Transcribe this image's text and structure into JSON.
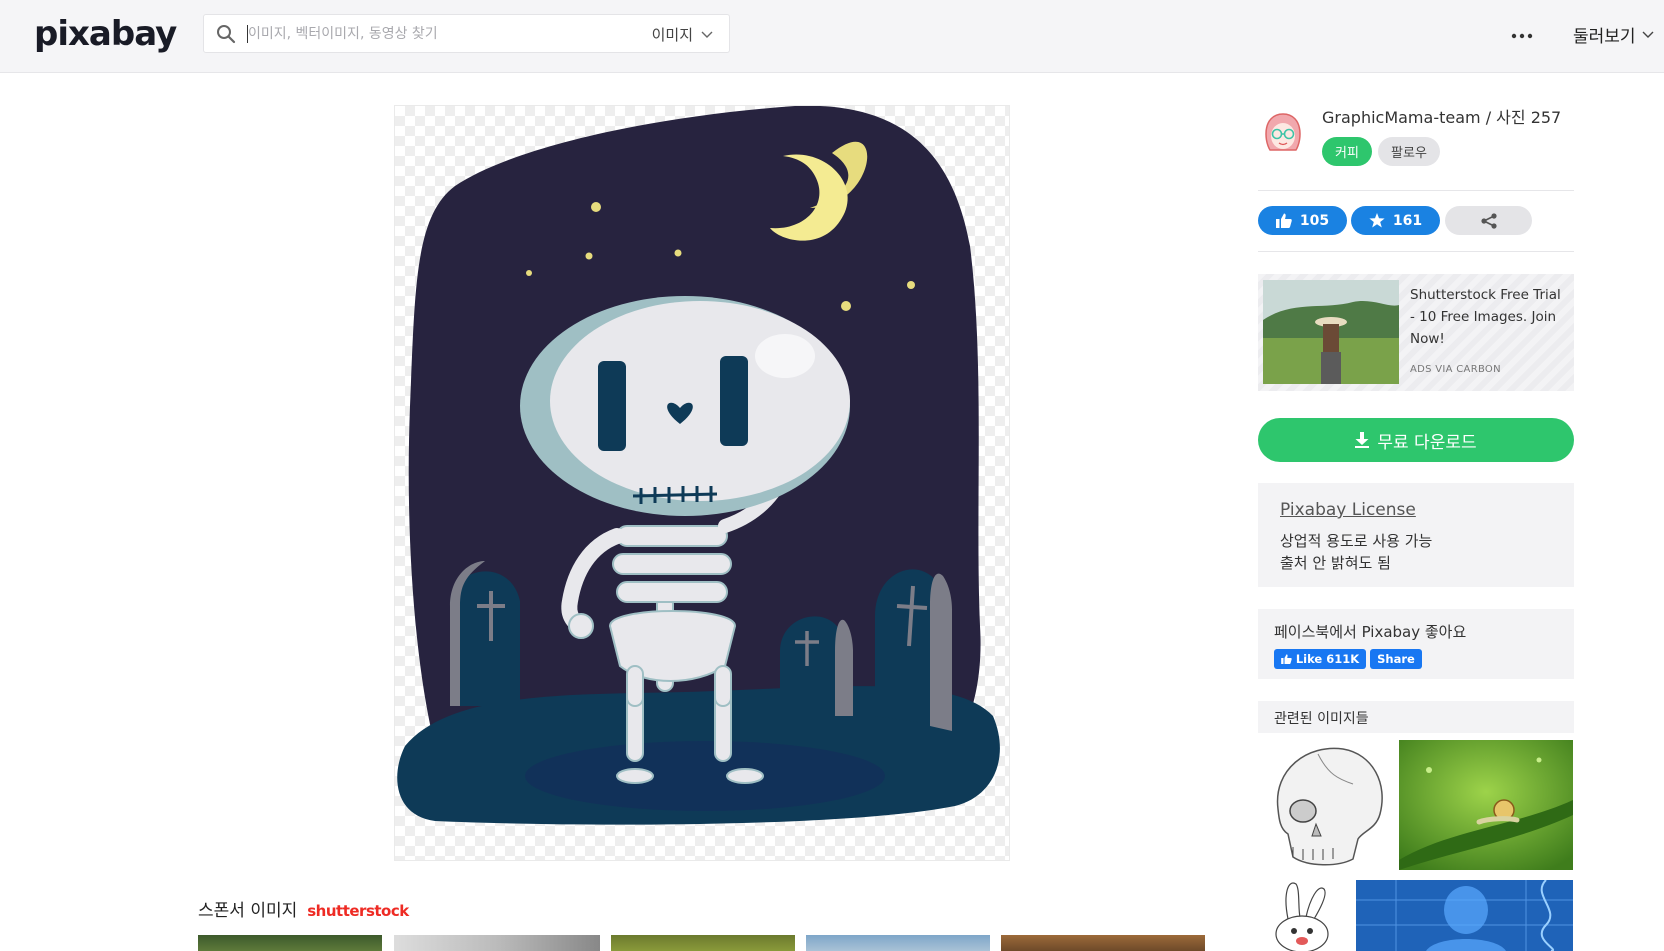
{
  "header": {
    "logo": "pixabay",
    "search_placeholder": "이미지, 벡터이미지, 동영상 찾기",
    "search_type": "이미지",
    "explore_label": "둘러보기"
  },
  "image": {
    "alt": "skeleton in graveyard at night"
  },
  "sponsor": {
    "label": "스폰서 이미지",
    "brand": "shutterstock"
  },
  "author": {
    "name_line": "GraphicMama-team / 사진 257",
    "coffee_label": "커피",
    "follow_label": "팔로우"
  },
  "actions": {
    "likes": "105",
    "favorites": "161"
  },
  "ad": {
    "title": "Shutterstock Free Trial - 10 Free Images. Join Now!",
    "via": "ADS VIA CARBON"
  },
  "download": {
    "label": "무료 다운로드"
  },
  "license": {
    "link": "Pixabay License",
    "line1": "상업적 용도로 사용 가능",
    "line2": "출처 안 밝혀도 됨"
  },
  "facebook": {
    "title": "페이스북에서 Pixabay 좋아요",
    "like_label": "Like 611K",
    "share_label": "Share"
  },
  "related": {
    "title": "관련된 이미지들"
  },
  "colors": {
    "brand_green": "#2ec66d",
    "action_blue": "#1a82e2",
    "sky": "#27233f",
    "ground": "#0e3a57"
  }
}
